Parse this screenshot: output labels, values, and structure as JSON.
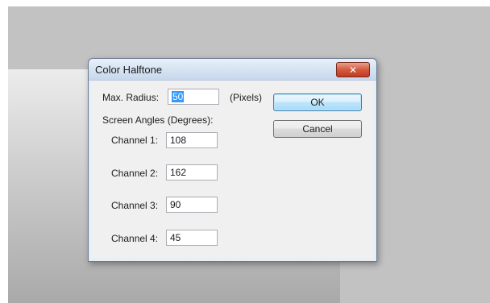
{
  "dialog": {
    "title": "Color Halftone",
    "max_radius_label": "Max. Radius:",
    "max_radius_value": "50",
    "max_radius_unit": "(Pixels)",
    "screen_angles_label": "Screen Angles (Degrees):",
    "channels": [
      {
        "label": "Channel 1:",
        "value": "108"
      },
      {
        "label": "Channel 2:",
        "value": "162"
      },
      {
        "label": "Channel 3:",
        "value": "90"
      },
      {
        "label": "Channel 4:",
        "value": "45"
      }
    ],
    "ok_label": "OK",
    "cancel_label": "Cancel"
  },
  "icons": {
    "close": "close-icon"
  },
  "colors": {
    "close_button": "#c13a20",
    "selection": "#3399ff",
    "workspace": "#c2c2c2"
  }
}
